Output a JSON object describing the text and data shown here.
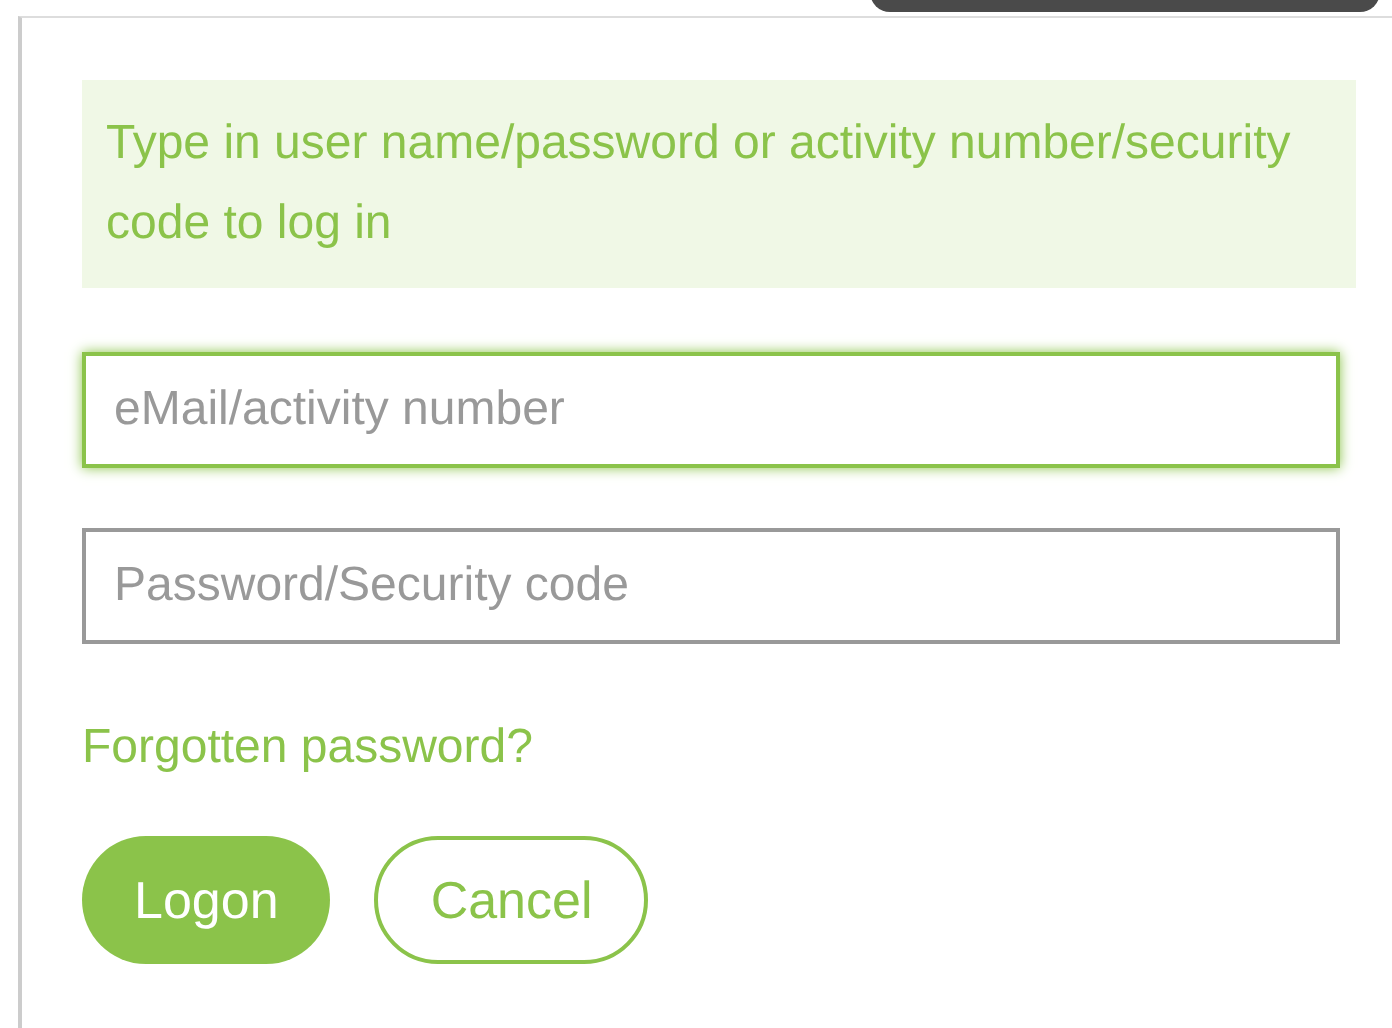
{
  "notice": "Type in user name/password or activity number/security code to log in",
  "fields": [
    {
      "placeholder": "eMail/activity number",
      "focused": true
    },
    {
      "placeholder": "Password/Security code",
      "focused": false
    }
  ],
  "forgot_link": "Forgotten password?",
  "buttons": [
    {
      "label": "Logon",
      "kind": "primary"
    },
    {
      "label": "Cancel",
      "kind": "secondary"
    }
  ]
}
